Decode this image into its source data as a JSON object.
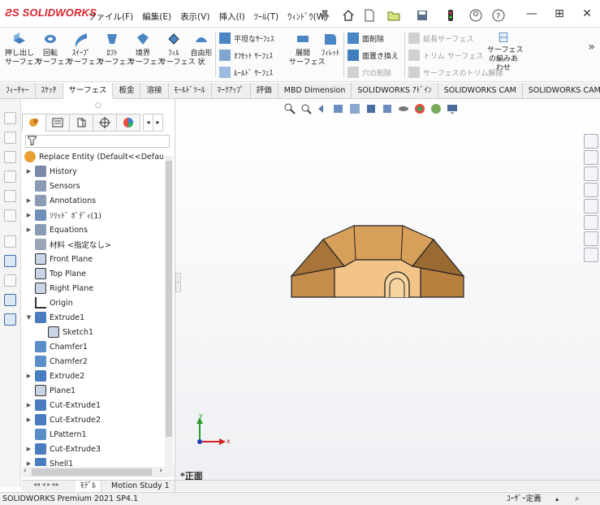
{
  "app": {
    "logo": "SOLIDWORKS",
    "menu": [
      "ファイル(F)",
      "編集(E)",
      "表示(V)",
      "挿入(I)",
      "ﾂｰﾙ(T)",
      "ｳｨﾝﾄﾞｳ(W)"
    ]
  },
  "ribbon": {
    "large_buttons": [
      {
        "label": "押し出し\nサーフェス",
        "icon": "extruded-surface-icon"
      },
      {
        "label": "回転\nサーフェス",
        "icon": "revolved-surface-icon"
      },
      {
        "label": "ｽｲｰﾌﾟ\nサーフェス",
        "icon": "swept-surface-icon"
      },
      {
        "label": "ﾛﾌﾄ\nサーフェス",
        "icon": "lofted-surface-icon"
      },
      {
        "label": "境界\nサーフェス",
        "icon": "boundary-surface-icon"
      },
      {
        "label": "ﾌｨﾙ\nサーフェス",
        "icon": "filled-surface-icon"
      },
      {
        "label": "自由形\n状",
        "icon": "freeform-icon"
      }
    ],
    "mid_items": [
      "平坦なｻｰﾌｪｽ",
      "ｵﾌｾｯﾄ ｻｰﾌｪｽ",
      "ﾙｰﾙﾄﾞ ｻｰﾌｪｽ"
    ],
    "flatten": "展開\nサーフェス",
    "fillet": "ﾌｨﾚｯﾄ",
    "right_items": [
      "面削除",
      "面置き換え",
      "穴の削除"
    ],
    "disabled_items": [
      "延長サーフェス",
      "トリム サーフェス",
      "サーフェスのトリム解除"
    ],
    "knit": "サーフェス\nの編みあ\nわせ"
  },
  "tabs": [
    "ﾌｨｰﾁｬｰ",
    "ｽｹｯﾁ",
    "サーフェス",
    "板金",
    "溶接",
    "ﾓｰﾙﾄﾞﾂｰﾙ",
    "ﾏｰｸｱｯﾌﾟ",
    "評価",
    "MBD Dimension",
    "SOLIDWORKS ｱﾄﾞｲﾝ",
    "SOLIDWORKS CAM",
    "SOLIDWORKS CAM T..."
  ],
  "active_tab": "サーフェス",
  "tree": {
    "root": "Replace Entity  (Default<<Default>_D",
    "items": [
      {
        "label": "History",
        "indent": 0,
        "arrow": "right",
        "icon": "history-icon"
      },
      {
        "label": "Sensors",
        "indent": 0,
        "arrow": "",
        "icon": "sensor-icon"
      },
      {
        "label": "Annotations",
        "indent": 0,
        "arrow": "right",
        "icon": "annotations-icon"
      },
      {
        "label": "ｿﾘｯﾄﾞ ﾎﾞﾃﾞｨ(1)",
        "indent": 0,
        "arrow": "right",
        "icon": "solid-bodies-icon"
      },
      {
        "label": "Equations",
        "indent": 0,
        "arrow": "right",
        "icon": "equations-icon"
      },
      {
        "label": "材料 <指定なし>",
        "indent": 0,
        "arrow": "",
        "icon": "material-icon"
      },
      {
        "label": "Front Plane",
        "indent": 0,
        "arrow": "",
        "icon": "plane-icon"
      },
      {
        "label": "Top Plane",
        "indent": 0,
        "arrow": "",
        "icon": "plane-icon"
      },
      {
        "label": "Right Plane",
        "indent": 0,
        "arrow": "",
        "icon": "plane-icon"
      },
      {
        "label": "Origin",
        "indent": 0,
        "arrow": "",
        "icon": "origin-icon"
      },
      {
        "label": "Extrude1",
        "indent": 0,
        "arrow": "down",
        "icon": "extrude-icon"
      },
      {
        "label": "Sketch1",
        "indent": 1,
        "arrow": "",
        "icon": "sketch-icon"
      },
      {
        "label": "Chamfer1",
        "indent": 0,
        "arrow": "",
        "icon": "chamfer-icon"
      },
      {
        "label": "Chamfer2",
        "indent": 0,
        "arrow": "",
        "icon": "chamfer-icon"
      },
      {
        "label": "Extrude2",
        "indent": 0,
        "arrow": "right",
        "icon": "extrude-icon"
      },
      {
        "label": "Plane1",
        "indent": 0,
        "arrow": "",
        "icon": "plane-icon"
      },
      {
        "label": "Cut-Extrude1",
        "indent": 0,
        "arrow": "right",
        "icon": "cut-extrude-icon"
      },
      {
        "label": "Cut-Extrude2",
        "indent": 0,
        "arrow": "right",
        "icon": "cut-extrude-icon"
      },
      {
        "label": "LPattern1",
        "indent": 0,
        "arrow": "",
        "icon": "linear-pattern-icon"
      },
      {
        "label": "Cut-Extrude3",
        "indent": 0,
        "arrow": "right",
        "icon": "cut-extrude-icon"
      },
      {
        "label": "Shell1",
        "indent": 0,
        "arrow": "right",
        "icon": "shell-icon"
      }
    ]
  },
  "bottom_tabs": [
    "ﾓﾃﾞﾙ",
    "Motion Study 1"
  ],
  "viewport": {
    "view_name": "*正面",
    "axis_x": "x",
    "axis_y": "y"
  },
  "status": {
    "left": "SOLIDWORKS Premium 2021 SP4.1",
    "right": "ﾕｰｻﾞｰ定義"
  }
}
